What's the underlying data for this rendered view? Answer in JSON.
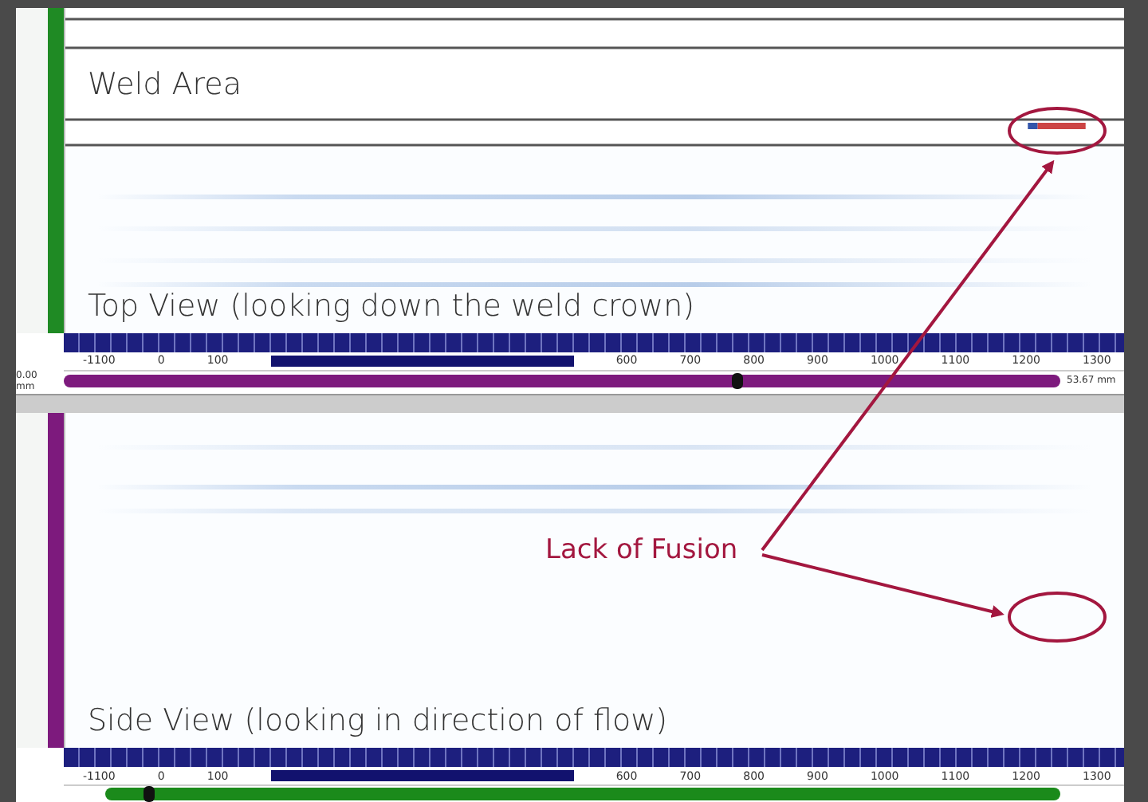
{
  "annotations": {
    "weld_area": "Weld Area",
    "top_view": "Top View (looking down the weld crown)",
    "callout": "Lack of Fusion",
    "side_view": "Side View (looking in direction of flow)"
  },
  "top_scale": {
    "labels": [
      "-1100",
      "0",
      "100",
      "600",
      "700",
      "800",
      "900",
      "1000",
      "1100",
      "1200",
      "1300"
    ],
    "start": "0.00 mm",
    "end": "53.67 mm",
    "level": 0.67
  },
  "side_scale": {
    "labels": [
      "-1100",
      "0",
      "100",
      "600",
      "700",
      "800",
      "900",
      "1000",
      "1100",
      "1200",
      "1300"
    ],
    "level": 0.04
  }
}
